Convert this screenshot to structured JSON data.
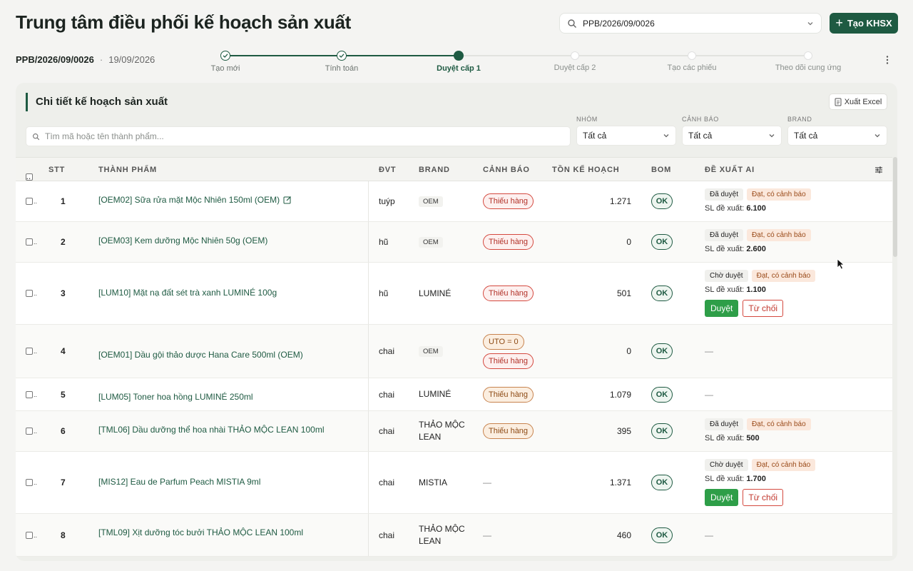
{
  "header": {
    "title": "Trung tâm điều phối kế hoạch sản xuất",
    "search_value": "PPB/2026/09/0026",
    "create_label": "Tạo KHSX"
  },
  "plan": {
    "code": "PPB/2026/09/0026",
    "separator": "·",
    "date": "19/09/2026"
  },
  "stepper": {
    "steps": [
      {
        "label": "Tạo mới",
        "state": "done"
      },
      {
        "label": "Tính toán",
        "state": "done"
      },
      {
        "label": "Duyệt cấp 1",
        "state": "active"
      },
      {
        "label": "Duyệt cấp 2",
        "state": "pending"
      },
      {
        "label": "Tạo các phiếu",
        "state": "pending"
      },
      {
        "label": "Theo dõi cung ứng",
        "state": "pending"
      }
    ]
  },
  "card": {
    "title": "Chi tiết kế hoạch sản xuất",
    "export_label": "Xuất Excel",
    "search_placeholder": "Tìm mã hoặc tên thành phẩm...",
    "filters": [
      {
        "label": "NHÓM",
        "value": "Tất cả"
      },
      {
        "label": "CẢNH BÁO",
        "value": "Tất cả"
      },
      {
        "label": "BRAND",
        "value": "Tất cả"
      }
    ]
  },
  "table": {
    "headers": {
      "stt": "STT",
      "product": "THÀNH PHẨM",
      "unit": "ĐVT",
      "brand": "BRAND",
      "warning": "CẢNH BÁO",
      "stock": "TỒN KẾ HOẠCH",
      "bom": "BOM",
      "ai": "ĐỀ XUẤT AI"
    },
    "ai_qty_label": "SL đề xuất:",
    "approve_label": "Duyệt",
    "reject_label": "Từ chối",
    "dash": "—",
    "rows": [
      {
        "stt": "1",
        "product": "[OEM02] Sữa rửa mặt Mộc Nhiên 150ml (OEM)",
        "edit": true,
        "unit": "tuýp",
        "brand": "OEM",
        "brand_tag": true,
        "warnings": [
          {
            "text": "Thiếu hàng",
            "type": "red"
          }
        ],
        "stock": "1.271",
        "bom": "OK",
        "ai": {
          "state": "Đã duyệt",
          "warn": "Đạt, có cảnh báo",
          "qty": "6.100",
          "buttons": false
        }
      },
      {
        "stt": "2",
        "product": "[OEM03] Kem dưỡng Mộc Nhiên 50g (OEM)",
        "edit": false,
        "unit": "hũ",
        "brand": "OEM",
        "brand_tag": true,
        "warnings": [
          {
            "text": "Thiếu hàng",
            "type": "red"
          }
        ],
        "stock": "0",
        "bom": "OK",
        "ai": {
          "state": "Đã duyệt",
          "warn": "Đạt, có cảnh báo",
          "qty": "2.600",
          "buttons": false
        }
      },
      {
        "stt": "3",
        "product": "[LUM10] Mặt nạ đất sét trà xanh LUMINÉ 100g",
        "edit": false,
        "unit": "hũ",
        "brand": "LUMINÉ",
        "brand_tag": false,
        "warnings": [
          {
            "text": "Thiếu hàng",
            "type": "red"
          }
        ],
        "stock": "501",
        "bom": "OK",
        "ai": {
          "state": "Chờ duyệt",
          "warn": "Đạt, có cảnh báo",
          "qty": "1.100",
          "buttons": true
        }
      },
      {
        "stt": "4",
        "product": "[OEM01] Dầu gội thảo dược Hana Care 500ml (OEM)",
        "edit": false,
        "unit": "chai",
        "brand": "OEM",
        "brand_tag": true,
        "warnings": [
          {
            "text": "UTO = 0",
            "type": "orange"
          },
          {
            "text": "Thiếu hàng",
            "type": "red"
          }
        ],
        "stock": "0",
        "bom": "OK",
        "ai": null
      },
      {
        "stt": "5",
        "product": "[LUM05] Toner hoa hồng LUMINÉ 250ml",
        "edit": false,
        "unit": "chai",
        "brand": "LUMINÉ",
        "brand_tag": false,
        "warnings": [
          {
            "text": "Thiếu hàng",
            "type": "orange"
          }
        ],
        "stock": "1.079",
        "bom": "OK",
        "ai": null
      },
      {
        "stt": "6",
        "product": "[TML06] Dầu dưỡng thể hoa nhài THẢO MỘC LEAN 100ml",
        "edit": false,
        "unit": "chai",
        "brand": "THẢO MỘC LEAN",
        "brand_tag": false,
        "warnings": [
          {
            "text": "Thiếu hàng",
            "type": "orange"
          }
        ],
        "stock": "395",
        "bom": "OK",
        "ai": {
          "state": "Đã duyệt",
          "warn": "Đạt, có cảnh báo",
          "qty": "500",
          "buttons": false
        }
      },
      {
        "stt": "7",
        "product": "[MIS12] Eau de Parfum Peach MISTIA 9ml",
        "edit": false,
        "unit": "chai",
        "brand": "MISTIA",
        "brand_tag": false,
        "warnings": [],
        "stock": "1.371",
        "bom": "OK",
        "ai": {
          "state": "Chờ duyệt",
          "warn": "Đạt, có cảnh báo",
          "qty": "1.700",
          "buttons": true
        }
      },
      {
        "stt": "8",
        "product": "[TML09] Xịt dưỡng tóc bưởi THẢO MỘC LEAN 100ml",
        "edit": false,
        "unit": "chai",
        "brand": "THẢO MỘC LEAN",
        "brand_tag": false,
        "warnings": [],
        "stock": "460",
        "bom": "OK",
        "ai": null
      }
    ]
  }
}
